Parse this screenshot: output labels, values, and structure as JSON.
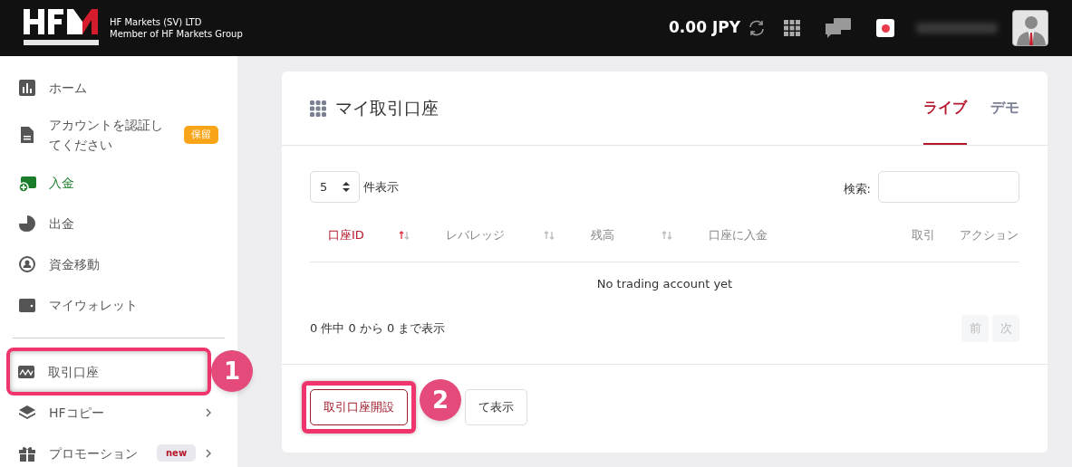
{
  "header": {
    "company_line_1": "HF Markets (SV) LTD",
    "company_line_2": "Member of HF Markets Group",
    "balance": "0.00 JPY"
  },
  "sidebar": {
    "items": [
      {
        "label": "ホーム",
        "selected": false,
        "highlighted": false
      },
      {
        "label": "アカウントを認証してください",
        "badge": "保留",
        "selected": false,
        "highlighted": false
      },
      {
        "label": "入金",
        "selected": true,
        "highlighted": false
      },
      {
        "label": "出金",
        "selected": false,
        "highlighted": false
      },
      {
        "label": "資金移動",
        "selected": false,
        "highlighted": false
      },
      {
        "label": "マイウォレット",
        "selected": false,
        "highlighted": false
      },
      {
        "kind": "divider"
      },
      {
        "label": "取引口座",
        "selected": false,
        "highlighted": true,
        "callout": "1"
      },
      {
        "label": "HFコピー",
        "selected": false,
        "highlighted": false,
        "submenu": true
      },
      {
        "label": "プロモーション",
        "selected": false,
        "highlighted": false,
        "submenu": true,
        "tag": "new"
      }
    ]
  },
  "card": {
    "title": "マイ取引口座",
    "tabs": [
      {
        "label": "ライブ",
        "selected": true
      },
      {
        "label": "デモ",
        "selected": false
      }
    ],
    "page_size": "5",
    "page_size_label": "件表示",
    "search_label": "検索:",
    "columns": [
      {
        "label": "口座ID",
        "sortable": true,
        "sorted": true
      },
      {
        "label": "レバレッジ",
        "sortable": true,
        "sorted": false
      },
      {
        "label": "残高",
        "sortable": true,
        "sorted": false
      },
      {
        "label": "口座に入金",
        "sortable": false,
        "sorted": false
      },
      {
        "label": "取引",
        "sortable": false,
        "sorted": false
      },
      {
        "label": "アクション",
        "sortable": false,
        "sorted": false
      }
    ],
    "empty_message": "No trading account yet",
    "summary": "0 件中 0 から 0 まで表示",
    "pager": [
      {
        "label": "前",
        "disabled": true
      },
      {
        "label": "次",
        "disabled": true
      }
    ],
    "open_button": {
      "label": "取引口座開設",
      "highlighted": true,
      "callout": "2"
    },
    "show_all_button": {
      "label": "て表示"
    }
  }
}
